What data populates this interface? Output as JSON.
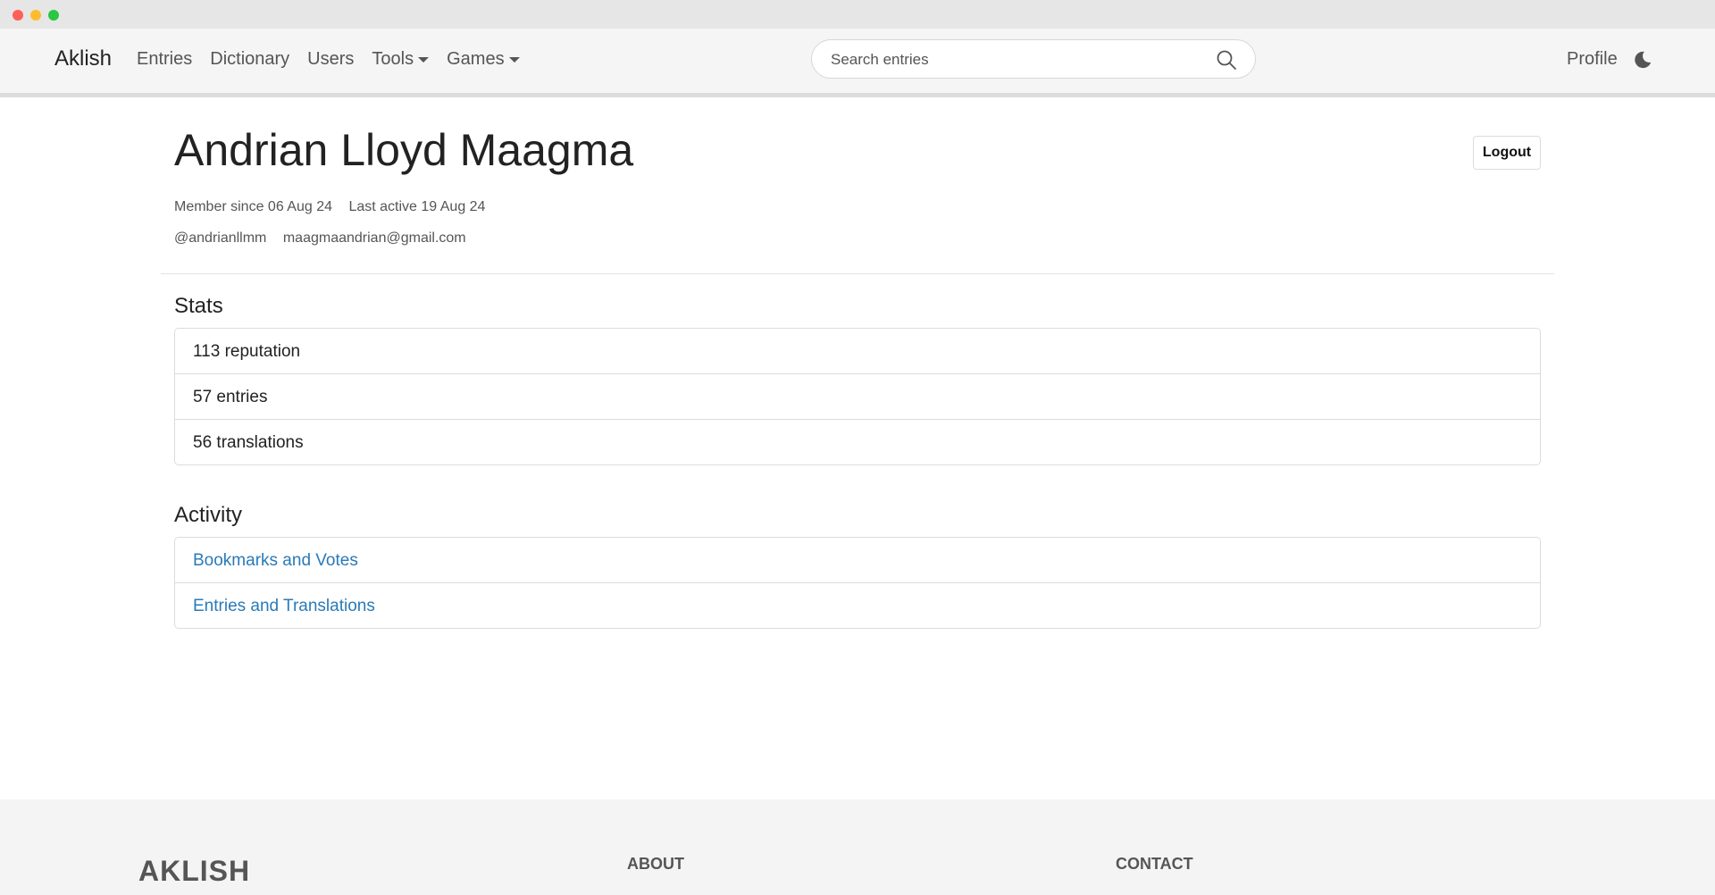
{
  "navbar": {
    "brand": "Aklish",
    "links": [
      "Entries",
      "Dictionary",
      "Users"
    ],
    "dropdowns": [
      "Tools",
      "Games"
    ],
    "search_placeholder": "Search entries",
    "profile_label": "Profile"
  },
  "profile": {
    "name": "Andrian Lloyd Maagma",
    "logout_label": "Logout",
    "member_since": "Member since 06 Aug 24",
    "last_active": "Last active 19 Aug 24",
    "username": "@andrianllmm",
    "email": "maagmaandrian@gmail.com"
  },
  "stats": {
    "title": "Stats",
    "items": [
      "113 reputation",
      "57 entries",
      "56 translations"
    ]
  },
  "activity": {
    "title": "Activity",
    "items": [
      "Bookmarks and Votes",
      "Entries and Translations"
    ]
  },
  "footer": {
    "brand": "AKLISH",
    "about_heading": "ABOUT",
    "contact_heading": "CONTACT"
  },
  "colors": {
    "link": "#2a7ab8",
    "navbar_bg": "#f5f5f5",
    "footer_bg": "#f4f4f4"
  }
}
